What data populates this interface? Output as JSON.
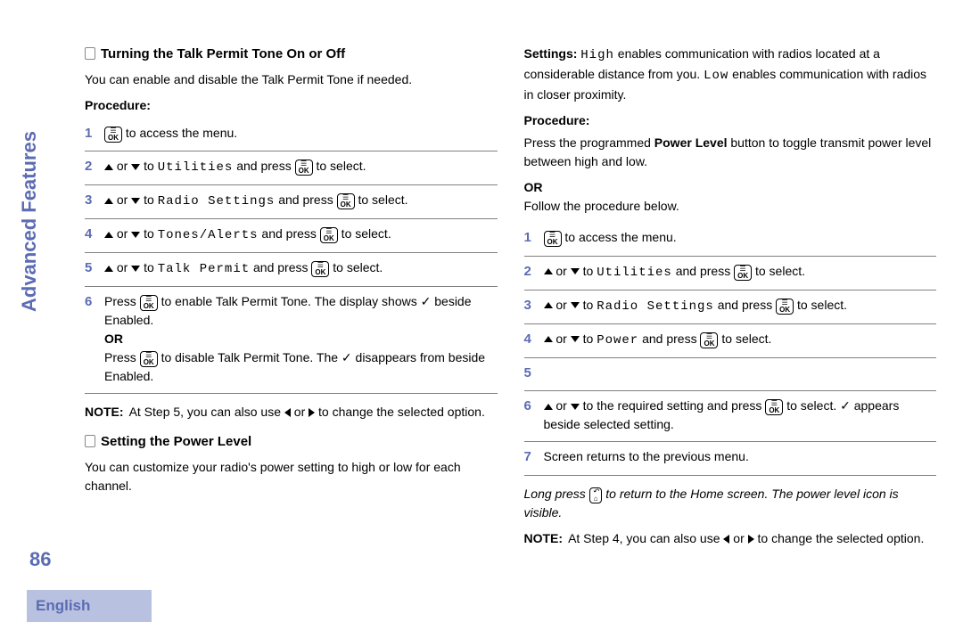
{
  "sidebar": {
    "label": "Advanced Features"
  },
  "pageNumber": "86",
  "language": "English",
  "left": {
    "h1": "Turning the Talk Permit Tone On or Off",
    "intro1": "You can enable and disable the Talk Permit Tone if needed.",
    "procLabel": "Procedure:",
    "s1a": " to access the menu.",
    "orword": " or ",
    "to": " to ",
    "andpress": " and press ",
    "toselect": " to select.",
    "m_util": "Utilities",
    "m_radio": "Radio Settings",
    "m_tones": "Tones/Alerts",
    "m_talk": "Talk Permit",
    "s6a": "Press ",
    "s6b": " to enable Talk Permit Tone. The display shows ✓ beside Enabled.",
    "or": "OR",
    "s6c": "Press ",
    "s6d": " to disable Talk Permit Tone. The ✓ disappears from beside Enabled.",
    "noteLabel": "NOTE:",
    "note1a": "At Step 5, you can also use ",
    "note1b": " to change the selected option.",
    "h2": "Setting the Power Level",
    "intro2": "You can customize your radio's power setting to high or low for each channel."
  },
  "right": {
    "settingsLabel": "Settings: ",
    "high": "High",
    "settings1": " enables communication with radios located at a considerable distance from you. ",
    "low": "Low",
    "settings2": " enables communication with radios in closer proximity.",
    "procLabel": "Procedure:",
    "pre1a": "Press the programmed ",
    "pre1b": "Power Level",
    "pre1c": " button to toggle transmit power level between high and low.",
    "or": "OR",
    "pre2": "Follow the procedure below.",
    "s1a": " to access the menu.",
    "orword": " or ",
    "to": " to ",
    "andpress": " and press ",
    "toselect": " to select.",
    "m_util": "Utilities",
    "m_radio": "Radio Settings",
    "m_power": "Power",
    "s6a": " to the required setting and press ",
    "s6b": " to select. ✓ appears beside selected setting.",
    "s7": "Screen returns to the previous menu.",
    "long1": "Long press ",
    "long2": " to return to the Home screen. The power level icon is visible.",
    "noteLabel": "NOTE:",
    "note1a": "At Step 4, you can also use ",
    "note1b": " to change the selected option."
  }
}
